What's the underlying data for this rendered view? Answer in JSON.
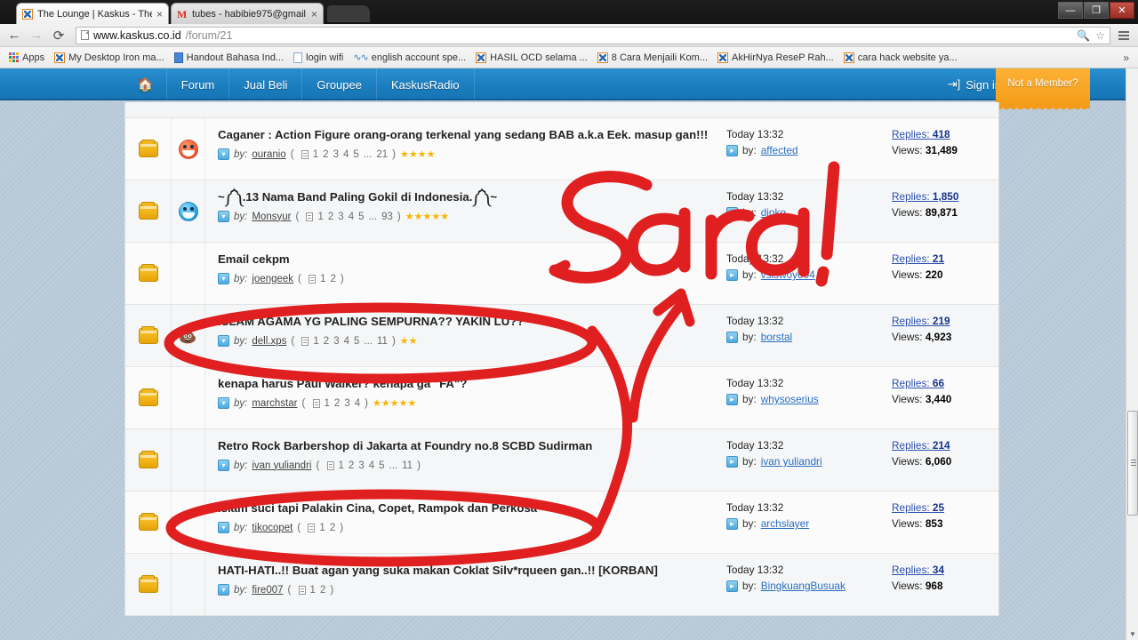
{
  "browser": {
    "tabs": [
      {
        "title": "The Lounge | Kaskus - The",
        "favicon": "kaskus-icon",
        "active": true,
        "close": "×"
      },
      {
        "title": "tubes - habibie975@gmail",
        "favicon": "gmail-icon",
        "active": false,
        "close": "×"
      }
    ],
    "window_buttons": {
      "minimize": "—",
      "maximize": "❐",
      "close": "✕"
    },
    "nav": {
      "back": "←",
      "forward": "→",
      "reload": "⟳"
    },
    "address": {
      "host": "www.kaskus.co.id",
      "path": "/forum/21",
      "zoom_icon": "magnifier-icon",
      "bookmark_icon": "star-icon",
      "menu_icon": "hamburger-menu-icon"
    },
    "bookmarks": {
      "apps_label": "Apps",
      "items": [
        {
          "label": "My Desktop Iron ma...",
          "icon": "kaskus-icon"
        },
        {
          "label": "Handout Bahasa Ind...",
          "icon": "document-icon"
        },
        {
          "label": "login wifi",
          "icon": "page-icon"
        },
        {
          "label": "english account spe...",
          "icon": "wave-icon"
        },
        {
          "label": "HASIL OCD selama ...",
          "icon": "kaskus-icon"
        },
        {
          "label": "8 Cara Menjaili Kom...",
          "icon": "kaskus-icon"
        },
        {
          "label": "AkHirNya ReseP Rah...",
          "icon": "kaskus-icon"
        },
        {
          "label": "cara hack website ya...",
          "icon": "kaskus-icon"
        }
      ],
      "overflow": "»"
    }
  },
  "site": {
    "nav": {
      "home_icon": "home-icon",
      "items": [
        "Forum",
        "Jual Beli",
        "Groupee",
        "KaskusRadio"
      ],
      "signin_label": "Sign in",
      "signin_icon": "signin-arrow-icon",
      "not_member_label": "Not a Member?"
    },
    "colors": {
      "nav_blue": "#1c7fc0",
      "accent_orange": "#f49b17",
      "link_blue": "#2a6fc0",
      "annotation_red": "#e02020"
    }
  },
  "threads": [
    {
      "folder_icon": "folder-icon",
      "emoticon": "angry-emoticon",
      "title": "Caganer : Action Figure orang-orang terkenal yang sedang BAB a.k.a Eek. masup gan!!!",
      "by_label": "by:",
      "author": "ouranio",
      "pages": [
        "1",
        "2",
        "3",
        "4",
        "5",
        "...",
        "21"
      ],
      "stars": 4,
      "last_time": "Today 13:32",
      "last_by_label": "by:",
      "last_author": "affected",
      "replies_label": "Replies:",
      "replies": "418",
      "views_label": "Views:",
      "views": "31,489"
    },
    {
      "folder_icon": "folder-icon",
      "emoticon": "blue-emoticon",
      "title": "~༼༽.13 Nama Band Paling Gokil di Indonesia.༼༽~",
      "by_label": "by:",
      "author": "Monsyur",
      "pages": [
        "1",
        "2",
        "3",
        "4",
        "5",
        "...",
        "93"
      ],
      "stars": 5,
      "last_time": "Today 13:32",
      "last_by_label": "by:",
      "last_author": "djoko",
      "replies_label": "Replies:",
      "replies": "1,850",
      "views_label": "Views:",
      "views": "89,871"
    },
    {
      "folder_icon": "folder-icon",
      "emoticon": "",
      "title": "Email cekpm",
      "by_label": "by:",
      "author": "joengeek",
      "pages": [
        "1",
        "2"
      ],
      "stars": 0,
      "last_time": "Today 13:32",
      "last_by_label": "by:",
      "last_author": "vsiswoyo04",
      "replies_label": "Replies:",
      "replies": "21",
      "views_label": "Views:",
      "views": "220"
    },
    {
      "folder_icon": "folder-icon",
      "emoticon": "poop-emoticon",
      "title": "ISLAM AGAMA YG PALING SEMPURNA?? YAKIN LU??",
      "by_label": "by:",
      "author": "dell.xps",
      "pages": [
        "1",
        "2",
        "3",
        "4",
        "5",
        "...",
        "11"
      ],
      "stars": 2,
      "last_time": "Today 13:32",
      "last_by_label": "by:",
      "last_author": "borstal",
      "replies_label": "Replies:",
      "replies": "219",
      "views_label": "Views:",
      "views": "4,923"
    },
    {
      "folder_icon": "folder-icon",
      "emoticon": "",
      "title": "kenapa harus Paul Walker? kenapa ga \"FA\"?",
      "by_label": "by:",
      "author": "marchstar",
      "pages": [
        "1",
        "2",
        "3",
        "4"
      ],
      "stars": 5,
      "last_time": "Today 13:32",
      "last_by_label": "by:",
      "last_author": "whysoserius",
      "replies_label": "Replies:",
      "replies": "66",
      "views_label": "Views:",
      "views": "3,440"
    },
    {
      "folder_icon": "folder-icon",
      "emoticon": "",
      "title": "Retro Rock Barbershop di Jakarta at Foundry no.8 SCBD Sudirman",
      "by_label": "by:",
      "author": "ivan yuliandri",
      "pages": [
        "1",
        "2",
        "3",
        "4",
        "5",
        "...",
        "11"
      ],
      "stars": 0,
      "last_time": "Today 13:32",
      "last_by_label": "by:",
      "last_author": "ivan yuliandri",
      "replies_label": "Replies:",
      "replies": "214",
      "views_label": "Views:",
      "views": "6,060"
    },
    {
      "folder_icon": "folder-icon",
      "emoticon": "",
      "title": "Islam suci tapi Palakin Cina, Copet, Rampok dan Perkosa",
      "by_label": "by:",
      "author": "tikocopet",
      "pages": [
        "1",
        "2"
      ],
      "stars": 0,
      "last_time": "Today 13:32",
      "last_by_label": "by:",
      "last_author": "archslayer",
      "replies_label": "Replies:",
      "replies": "25",
      "views_label": "Views:",
      "views": "853"
    },
    {
      "folder_icon": "folder-icon",
      "emoticon": "",
      "title": "HATI-HATI..!! Buat agan yang suka makan Coklat Silv*rqueen gan..!! [KORBAN]",
      "by_label": "by:",
      "author": "fire007",
      "pages": [
        "1",
        "2"
      ],
      "stars": 0,
      "last_time": "Today 13:32",
      "last_by_label": "by:",
      "last_author": "BingkuangBusuak",
      "replies_label": "Replies:",
      "replies": "34",
      "views_label": "Views:",
      "views": "968"
    }
  ],
  "annotation": {
    "text": "Sara!",
    "color": "#e02020",
    "marks": [
      "handwritten-word",
      "ellipse-row-4",
      "ellipse-row-7",
      "arrow-up"
    ]
  }
}
